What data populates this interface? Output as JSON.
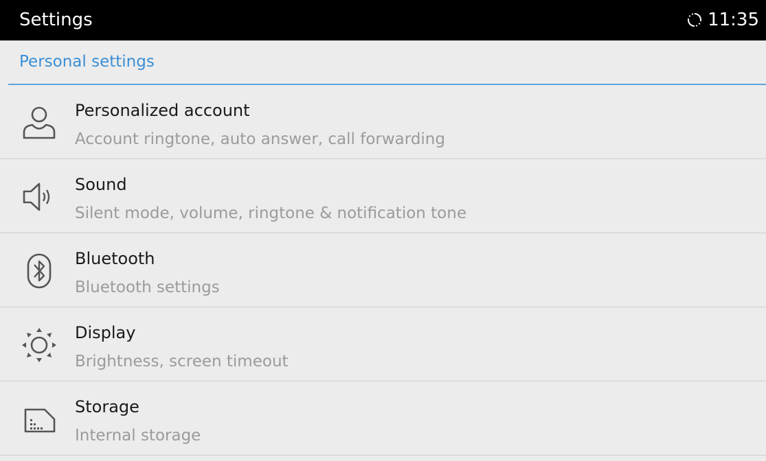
{
  "status_bar": {
    "title": "Settings",
    "time": "11:35",
    "sync_icon": "sync-icon"
  },
  "section": {
    "title": "Personal settings",
    "accent_color": "#3a8fd6"
  },
  "items": [
    {
      "title": "Personalized account",
      "subtitle": "Account ringtone, auto answer, call forwarding",
      "icon": "account-icon"
    },
    {
      "title": "Sound",
      "subtitle": "Silent mode, volume, ringtone & notification tone",
      "icon": "speaker-icon"
    },
    {
      "title": "Bluetooth",
      "subtitle": "Bluetooth settings",
      "icon": "bluetooth-icon"
    },
    {
      "title": "Display",
      "subtitle": "Brightness, screen timeout",
      "icon": "brightness-icon"
    },
    {
      "title": "Storage",
      "subtitle": "Internal storage",
      "icon": "sd-card-icon"
    }
  ]
}
